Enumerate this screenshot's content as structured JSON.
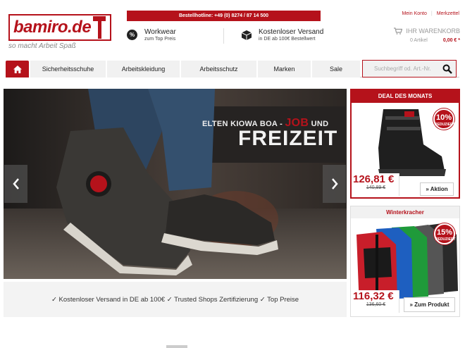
{
  "header": {
    "logo_text": "bamiro.de",
    "tagline": "so macht Arbeit Spaß",
    "hotline": "Bestellhotline: +49 (0) 8274 / 87 14 500",
    "usp1_title": "Workwear",
    "usp1_sub": "zum Top Preis",
    "usp2_title": "Kostenloser Versand",
    "usp2_sub": "in DE ab 100€ Bestellwert",
    "account_link": "Mein Konto",
    "wishlist_link": "Merkzettel",
    "cart_title": "IHR WARENKORB",
    "cart_items": "0 Artikel",
    "cart_total": "0,00 € *"
  },
  "nav": {
    "items": [
      {
        "label": "Sicherheitsschuhe"
      },
      {
        "label": "Arbeitskleidung"
      },
      {
        "label": "Arbeitsschutz"
      },
      {
        "label": "Marken"
      },
      {
        "label": "Sale"
      }
    ],
    "search_placeholder": "Suchbegriff od. Art.-Nr."
  },
  "hero": {
    "line1_a": "ELTEN KIOWA BOA - ",
    "line1_b": "JOB",
    "line1_c": " UND",
    "line2": "FREIZEIT"
  },
  "usp_bar": "✓ Kostenloser Versand in DE ab 100€ ✓ Trusted Shops Zertifizierung ✓ Top Preise",
  "deal": {
    "title": "DEAL DES MONATS",
    "badge_pct": "10%",
    "badge_label": "REDUZIERT",
    "price": "126,81 €",
    "old_price": "140,89 €",
    "button": "» Aktion"
  },
  "winter": {
    "title": "Winterkracher",
    "badge_pct": "15%",
    "badge_label": "REDUZIERT",
    "price": "116,32 €",
    "old_price": "136,60 €",
    "button": "» Zum Produkt"
  },
  "colors": {
    "brand": "#b5121b"
  }
}
